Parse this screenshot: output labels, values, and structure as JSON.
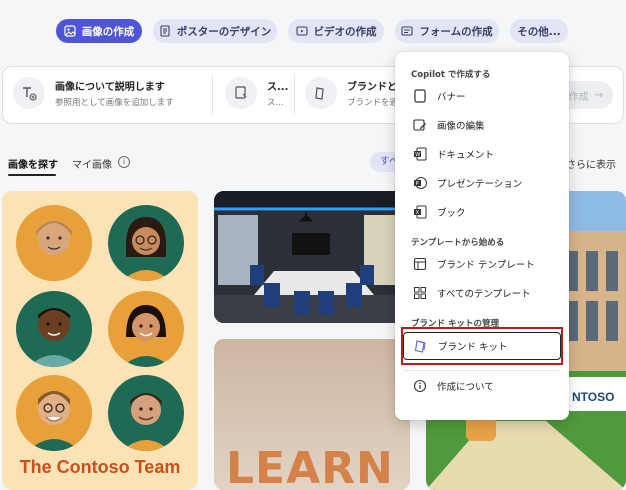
{
  "top_tabs": [
    {
      "label": "画像の作成",
      "icon": "image-icon"
    },
    {
      "label": "ポスターのデザイン",
      "icon": "poster-icon"
    },
    {
      "label": "ビデオの作成",
      "icon": "video-icon"
    },
    {
      "label": "フォームの作成",
      "icon": "form-icon"
    },
    {
      "label": "その他..."
    }
  ],
  "prompt_cards": [
    {
      "title": "画像について説明します",
      "subtitle": "参照用として画像を追加します",
      "icon": "add-image-text-icon"
    },
    {
      "title": "ス...",
      "subtitle": "ス...",
      "icon": "style-icon"
    },
    {
      "title": "ブランドとも",
      "subtitle": "ブランドを適用",
      "icon": "brand-icon"
    }
  ],
  "generate_button": {
    "label": "作成"
  },
  "gallery_tabs": {
    "explore": "画像を探す",
    "mine": "マイ画像",
    "all_chip": "すべ",
    "show_more": "さらに表示"
  },
  "cards": {
    "team_caption": "The Contoso Team",
    "learn_letters": "LEARN",
    "building_sign": "NTOSO"
  },
  "menu": {
    "section_copilot": "Copilot で作成する",
    "items_copilot": [
      {
        "label": "バナー",
        "icon": "banner-icon"
      },
      {
        "label": "画像の編集",
        "icon": "image-edit-icon"
      },
      {
        "label": "ドキュメント",
        "icon": "word-icon"
      },
      {
        "label": "プレゼンテーション",
        "icon": "powerpoint-icon"
      },
      {
        "label": "ブック",
        "icon": "excel-icon"
      }
    ],
    "section_templates": "テンプレートから始める",
    "items_templates": [
      {
        "label": "ブランド テンプレート",
        "icon": "brand-template-icon"
      },
      {
        "label": "すべてのテンプレート",
        "icon": "grid-icon"
      }
    ],
    "section_brand": "ブランド キットの管理",
    "brand_kit": {
      "label": "ブランド キット",
      "icon": "brand-kit-icon"
    },
    "about": {
      "label": "作成について",
      "icon": "info-icon"
    }
  },
  "colors": {
    "accent": "#4f55d6",
    "highlight": "#c01b1b",
    "team_bg": "#fbe3b6",
    "team_caption": "#c8501e"
  }
}
